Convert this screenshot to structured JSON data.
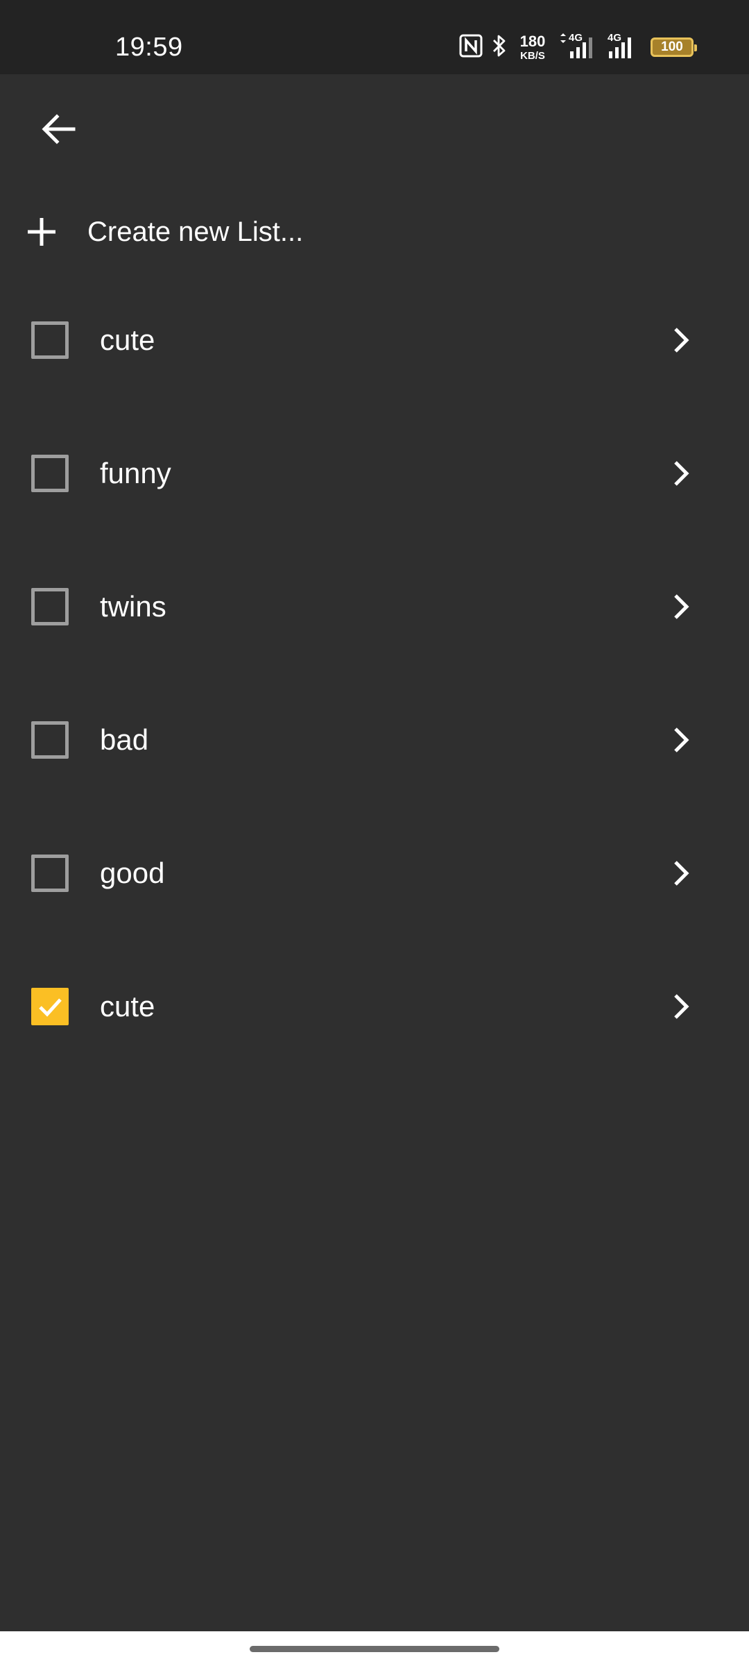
{
  "status_bar": {
    "time": "19:59",
    "net_speed_value": "180",
    "net_speed_unit": "KB/S",
    "signal_1_label": "4G",
    "signal_2_label": "4G",
    "battery_level": "100",
    "icons": [
      "nfc-icon",
      "bluetooth-icon",
      "data-arrows-icon",
      "signal-icon",
      "signal-icon",
      "battery-icon"
    ]
  },
  "toolbar": {
    "back_icon": "arrow-left-icon"
  },
  "create_list": {
    "icon": "plus-icon",
    "label": "Create new List..."
  },
  "lists": [
    {
      "label": "cute",
      "checked": false
    },
    {
      "label": "funny",
      "checked": false
    },
    {
      "label": "twins",
      "checked": false
    },
    {
      "label": "bad",
      "checked": false
    },
    {
      "label": "good",
      "checked": false
    },
    {
      "label": "cute",
      "checked": true
    }
  ],
  "colors": {
    "background": "#2f2f2f",
    "status_bar": "#232323",
    "checkbox_checked": "#fbbf24",
    "checkbox_unchecked_border": "#9e9e9e",
    "text": "#ffffff"
  }
}
